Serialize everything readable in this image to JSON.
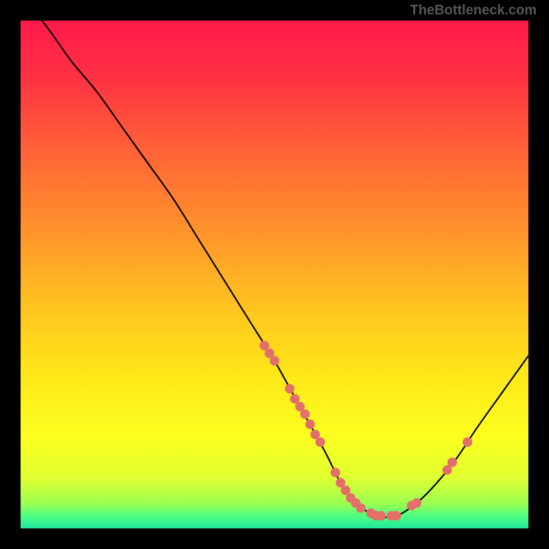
{
  "watermark": "TheBottleneck.com",
  "chart_data": {
    "type": "line",
    "title": "",
    "xlabel": "",
    "ylabel": "",
    "xlim": [
      0,
      100
    ],
    "ylim": [
      0,
      100
    ],
    "gradient_stops": [
      {
        "offset": 0.0,
        "color": "#ff1a4a"
      },
      {
        "offset": 0.1,
        "color": "#ff2e44"
      },
      {
        "offset": 0.25,
        "color": "#ff6038"
      },
      {
        "offset": 0.4,
        "color": "#ff8f2c"
      },
      {
        "offset": 0.55,
        "color": "#ffbf20"
      },
      {
        "offset": 0.7,
        "color": "#ffe818"
      },
      {
        "offset": 0.82,
        "color": "#fcff20"
      },
      {
        "offset": 0.9,
        "color": "#e0ff30"
      },
      {
        "offset": 0.95,
        "color": "#9eff50"
      },
      {
        "offset": 0.975,
        "color": "#50ff80"
      },
      {
        "offset": 1.0,
        "color": "#20e8a0"
      }
    ],
    "series": [
      {
        "name": "bottleneck-curve",
        "color": "#000000",
        "x": [
          0,
          5,
          10,
          15,
          20,
          25,
          30,
          35,
          40,
          45,
          50,
          55,
          60,
          63,
          66,
          70,
          74,
          78,
          82,
          86,
          90,
          95,
          100
        ],
        "y": [
          105,
          99,
          92,
          86,
          79,
          72,
          65,
          57,
          49,
          41,
          33,
          24,
          15,
          9,
          5,
          2.5,
          2.5,
          5,
          9,
          14,
          20,
          27,
          34
        ]
      }
    ],
    "markers": {
      "name": "highlighted-points",
      "color": "#e36f6a",
      "radius": 7,
      "points": [
        {
          "x": 48,
          "y": 36
        },
        {
          "x": 49,
          "y": 34.5
        },
        {
          "x": 50,
          "y": 33
        },
        {
          "x": 53,
          "y": 27.5
        },
        {
          "x": 54,
          "y": 25.5
        },
        {
          "x": 55,
          "y": 24
        },
        {
          "x": 56,
          "y": 22.5
        },
        {
          "x": 57,
          "y": 20.5
        },
        {
          "x": 58,
          "y": 18.5
        },
        {
          "x": 59,
          "y": 17
        },
        {
          "x": 62,
          "y": 11
        },
        {
          "x": 63,
          "y": 9
        },
        {
          "x": 64,
          "y": 7.5
        },
        {
          "x": 65,
          "y": 6
        },
        {
          "x": 66,
          "y": 5
        },
        {
          "x": 67,
          "y": 4
        },
        {
          "x": 69,
          "y": 3
        },
        {
          "x": 70,
          "y": 2.5
        },
        {
          "x": 71,
          "y": 2.5
        },
        {
          "x": 73,
          "y": 2.5
        },
        {
          "x": 74,
          "y": 2.5
        },
        {
          "x": 77,
          "y": 4.5
        },
        {
          "x": 78,
          "y": 5
        },
        {
          "x": 84,
          "y": 11.5
        },
        {
          "x": 85,
          "y": 13
        },
        {
          "x": 88,
          "y": 17
        }
      ]
    }
  }
}
